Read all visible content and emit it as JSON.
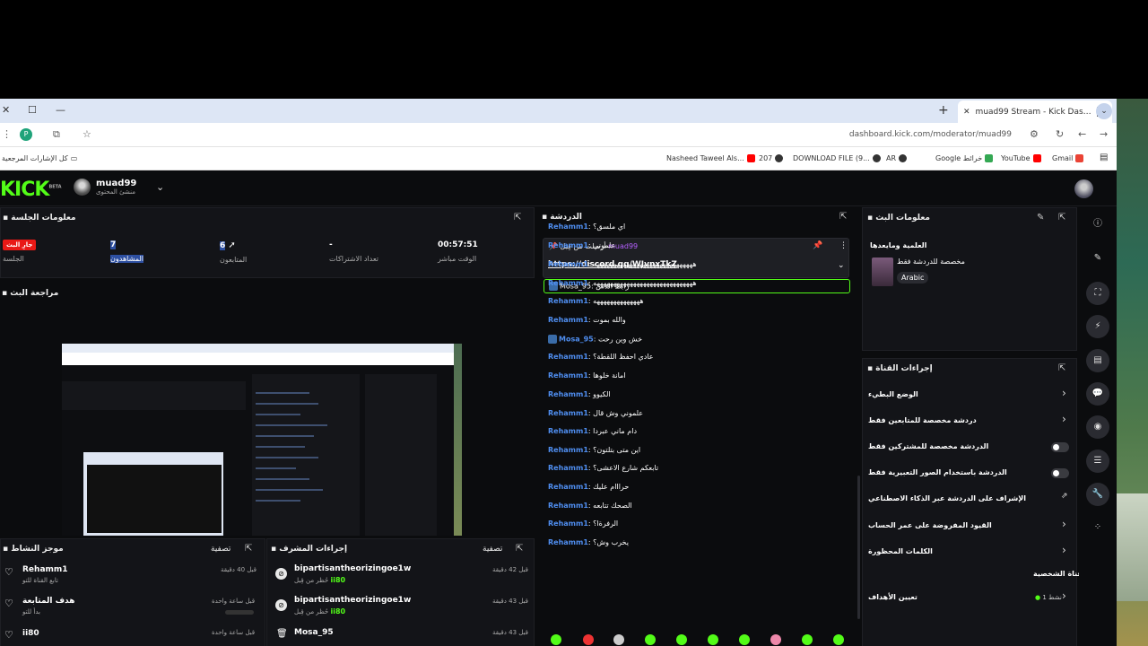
{
  "browser": {
    "tab_title": "muad99 Stream - Kick Dashbo...",
    "url": "dashboard.kick.com/moderator/muad99",
    "bookmarks_folder": "كل الإشارات المرجعية",
    "bookmarks": [
      {
        "label": "Gmail",
        "color": "#ea4335"
      },
      {
        "label": "YouTube",
        "color": "#ff0000"
      },
      {
        "label": "Google خرائط",
        "color": "#34a853"
      },
      {
        "label": "AR",
        "color": "#333333"
      },
      {
        "label": "DOWNLOAD FILE (9...",
        "color": "#333333"
      },
      {
        "label": "207",
        "color": "#333333"
      },
      {
        "label": "Nasheed Taweel Als...",
        "color": "#ff0000"
      }
    ]
  },
  "kick": {
    "logo": "KICK",
    "beta": "BETA",
    "channel_name": "muad99",
    "channel_role": "منشئ المحتوى"
  },
  "session": {
    "title": "معلومات الجلسة",
    "live_badge": "جارِ البث",
    "session_label": "الجلسة",
    "viewers_value": "7",
    "viewers_label": "المشاهدون",
    "followers_value": "6",
    "followers_label": "المتابعون",
    "subs_value": "-",
    "subs_label": "تعداد الاشتراكات",
    "uptime_value": "00:57:51",
    "uptime_label": "الوقت مباشر"
  },
  "preview": {
    "title": "مراجعة البث"
  },
  "activity": {
    "title": "موجز النشاط",
    "filter": "تصفية",
    "items": [
      {
        "user": "Rehamm1",
        "sub": "تابع القناة للتو",
        "time": "قبل 40 دقيقة"
      },
      {
        "user": "هدف المتابعة",
        "sub": "بدأ للتو",
        "time": "قبل ساعة واحدة"
      },
      {
        "user": "ii80",
        "sub": "",
        "time": "قبل ساعة واحدة"
      }
    ]
  },
  "mod_actions": {
    "title": "إجراءات المشرف",
    "filter": "تصفية",
    "items": [
      {
        "user": "bipartisantheorizingoe1w",
        "sub": "حُظر من قِبل",
        "by": "ii80",
        "time": "قبل 42 دقيقة"
      },
      {
        "user": "bipartisantheorizingoe1w",
        "sub": "حُظر من قِبل",
        "by": "ii80",
        "time": "قبل 43 دقيقة"
      },
      {
        "user": "Mosa_95",
        "sub": "",
        "by": "",
        "time": "قبل 43 دقيقة"
      }
    ]
  },
  "chat": {
    "title": "الدردشة",
    "pinned_header": "أرسلت من قِبل",
    "pinned_by": "muad99",
    "pinned_link": "https://discord.gg/WJvnxTkZ",
    "highlight": {
      "user": "Mosa_95",
      "text": "رابط الدس"
    },
    "messages": [
      {
        "user": "Rehamm1",
        "text": "اي ملسق؟"
      },
      {
        "user": "Rehamm1",
        "text": "علموني"
      },
      {
        "user": "Rehamm1",
        "text": "ههههههههههههههههههههههههههههههه"
      },
      {
        "user": "Rehamm1",
        "text": "ههههههههههههههههههههههههههههههه"
      },
      {
        "user": "Rehamm1",
        "text": "ههههههههههههههه"
      },
      {
        "user": "Rehamm1",
        "text": "والله بموت"
      },
      {
        "user": "Mosa_95",
        "text": "خش وين رحت"
      },
      {
        "user": "Rehamm1",
        "text": "عادي احفظ اللقطة؟"
      },
      {
        "user": "Rehamm1",
        "text": "امانة خلوها"
      },
      {
        "user": "Rehamm1",
        "text": "الكيوو"
      },
      {
        "user": "Rehamm1",
        "text": "علموني وش قال"
      },
      {
        "user": "Rehamm1",
        "text": "دام ماني عبردا"
      },
      {
        "user": "Rehamm1",
        "text": "اين متى بتلتون؟"
      },
      {
        "user": "Rehamm1",
        "text": "تابعكم شارع الاعشى؟"
      },
      {
        "user": "Rehamm1",
        "text": "حرااام عليك"
      },
      {
        "user": "Rehamm1",
        "text": "الصحك تتابعه"
      },
      {
        "user": "Rehamm1",
        "text": "الرفرةا؟"
      },
      {
        "user": "Rehamm1",
        "text": "يخرب وش؟"
      }
    ]
  },
  "stream_info": {
    "title": "معلومات البث",
    "category_title": "العلمية ومايعدها",
    "category_sub": "مخصصة للدردشة فقط",
    "language": "Arabic"
  },
  "channel_actions": {
    "title": "إجراءات القناة",
    "items": [
      {
        "label": "الوضع البطيء",
        "control": "arrow"
      },
      {
        "label": "دردشة مخصصة للمتابعين فقط",
        "control": "arrow"
      },
      {
        "label": "الدردشة مخصصة للمشتركين فقط",
        "control": "toggle"
      },
      {
        "label": "الدردشة باستخدام الصور التعبيرية فقط",
        "control": "toggle"
      },
      {
        "label": "الإشراف على الدردشة عبر الذكاء الاصطناعي",
        "control": "link"
      },
      {
        "label": "القيود المفروضة على عمر الحساب",
        "control": "arrow"
      },
      {
        "label": "الكلمات المحظورة",
        "control": "arrow"
      }
    ],
    "custom_section": "القناة الشخصية",
    "goals_label": "تعيين الأهداف",
    "goals_count": "1 نشط"
  }
}
